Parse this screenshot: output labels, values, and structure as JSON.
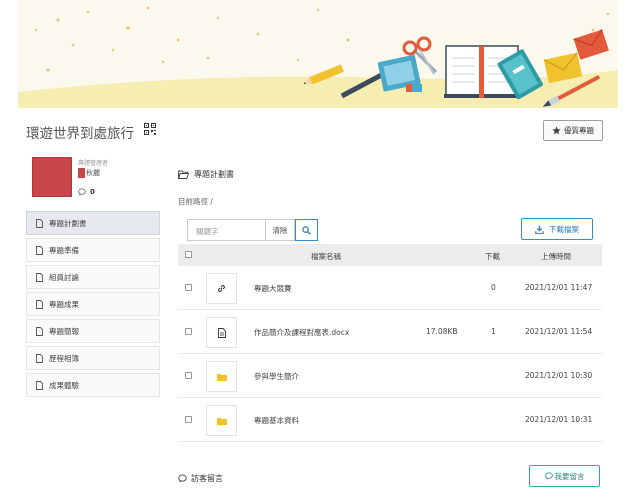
{
  "project": {
    "title": "環遊世界到處旅行"
  },
  "header": {
    "favorite_label": "優質專題"
  },
  "profile": {
    "role": "專題管理者",
    "name": "秋麗",
    "comment_count": "0"
  },
  "sidebar": {
    "items": [
      {
        "label": "專題計劃書",
        "active": true
      },
      {
        "label": "專題準備",
        "active": false
      },
      {
        "label": "組員討論",
        "active": false
      },
      {
        "label": "專題成果",
        "active": false
      },
      {
        "label": "專題簡報",
        "active": false
      },
      {
        "label": "歷程相簿",
        "active": false
      },
      {
        "label": "成果體驗",
        "active": false
      }
    ]
  },
  "main": {
    "section_title": "專題計劃書",
    "path_label": "目前路徑 /",
    "search": {
      "placeholder": "關鍵字",
      "clear_label": "清除"
    },
    "download_label": "下載檔案",
    "table": {
      "headers": {
        "name": "檔案名稱",
        "downloads": "下載",
        "time": "上傳時間"
      },
      "rows": [
        {
          "icon": "link-icon",
          "name": "專題大競賽",
          "size": "",
          "downloads": "0",
          "time": "2021/12/01 11:47"
        },
        {
          "icon": "document-icon",
          "name": "作品簡介及課程對應表.docx",
          "size": "17.08KB",
          "downloads": "1",
          "time": "2021/12/01 11:54"
        },
        {
          "icon": "folder-icon",
          "name": "參與學生簡介",
          "size": "",
          "downloads": "",
          "time": "2021/12/01 10:30"
        },
        {
          "icon": "folder-icon",
          "name": "專題基本資料",
          "size": "",
          "downloads": "",
          "time": "2021/12/01 10:31"
        }
      ]
    }
  },
  "guestbook": {
    "title": "訪客留言",
    "comment_button": "我要留言"
  },
  "colors": {
    "accent_blue": "#3a8cc4",
    "accent_teal": "#3aaa98",
    "avatar": "#c8464a",
    "folder": "#f2c12e"
  }
}
